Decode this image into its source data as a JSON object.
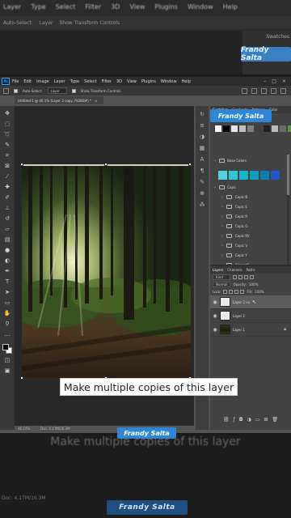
{
  "background": {
    "menu": [
      "Layer",
      "Type",
      "Select",
      "Filter",
      "3D",
      "View",
      "Plugins",
      "Window",
      "Help"
    ],
    "options": {
      "auto_select": "Auto-Select:",
      "layer": "Layer",
      "show_transform": "Show Transform Controls"
    },
    "tabs": [
      "Swatches"
    ],
    "ghost_caption": "Make multiple copies of this layer",
    "stats": "Doc: 4.17M/16.3M"
  },
  "brand": {
    "name": "Frandy Saltа",
    "color": "#2f86d6"
  },
  "menubar": {
    "logo": "Ps",
    "items": [
      "File",
      "Edit",
      "Image",
      "Layer",
      "Type",
      "Select",
      "Filter",
      "3D",
      "View",
      "Plugins",
      "Window",
      "Help"
    ],
    "window_controls": [
      "–",
      "□",
      "×"
    ]
  },
  "options_bar": {
    "auto_select": "Auto-Select:",
    "layer_select": "Layer",
    "show_transform": "Show Transform Controls"
  },
  "document": {
    "tab_title": "Untitled-1 @ 46.1% (Layer 2 copy, RGB/8#) *",
    "close": "×",
    "status_zoom": "46.14%",
    "status_doc": "Doc: 4.17M/16.3M"
  },
  "tools": [
    "move-icon",
    "marquee-icon",
    "lasso-icon",
    "quick-select-icon",
    "crop-icon",
    "frame-icon",
    "eyedropper-icon",
    "healing-icon",
    "brush-icon",
    "stamp-icon",
    "history-brush-icon",
    "eraser-icon",
    "gradient-icon",
    "blur-icon",
    "dodge-icon",
    "pen-icon",
    "type-icon",
    "path-select-icon",
    "shape-icon",
    "hand-icon",
    "zoom-icon",
    "more-icon"
  ],
  "swatches_panel": {
    "tabs": [
      "Swatches",
      "Gradients",
      "Patterns",
      "Color"
    ],
    "recent_colors": [
      "#ffffff",
      "#000000",
      "#e6e6e6",
      "#bfbfbf",
      "#7f7f7f",
      "#404040",
      "#1f1f1f",
      "#bcbcbc",
      "#6a6a6a",
      "#5e9b3d",
      "#e87c2a"
    ],
    "base_group": "Base Colors",
    "base_colors": [
      "#4fd5e0",
      "#2fc6d8",
      "#14b4cc",
      "#0f9fbd",
      "#0d7fae",
      "#1f57c4"
    ],
    "copic_group": "Copic",
    "copic_items": [
      "Copic B",
      "Copic E",
      "Copic R",
      "Copic G",
      "Copic RV",
      "Copic V",
      "Copic Y",
      "Copic YG",
      "Copic YR"
    ]
  },
  "layers_panel": {
    "tabs": [
      "Layers",
      "Channels",
      "Paths"
    ],
    "kind": "Kind",
    "blend_mode": "Normal",
    "opacity_label": "Opacity:",
    "opacity_value": "100%",
    "lock_label": "Lock:",
    "fill_label": "Fill:",
    "fill_value": "100%",
    "layers": [
      {
        "name": "Layer 2 co",
        "selected": true
      },
      {
        "name": "Layer 2",
        "selected": false
      },
      {
        "name": "Layer 1",
        "selected": false
      }
    ]
  },
  "caption": "Make multiple copies of this layer"
}
